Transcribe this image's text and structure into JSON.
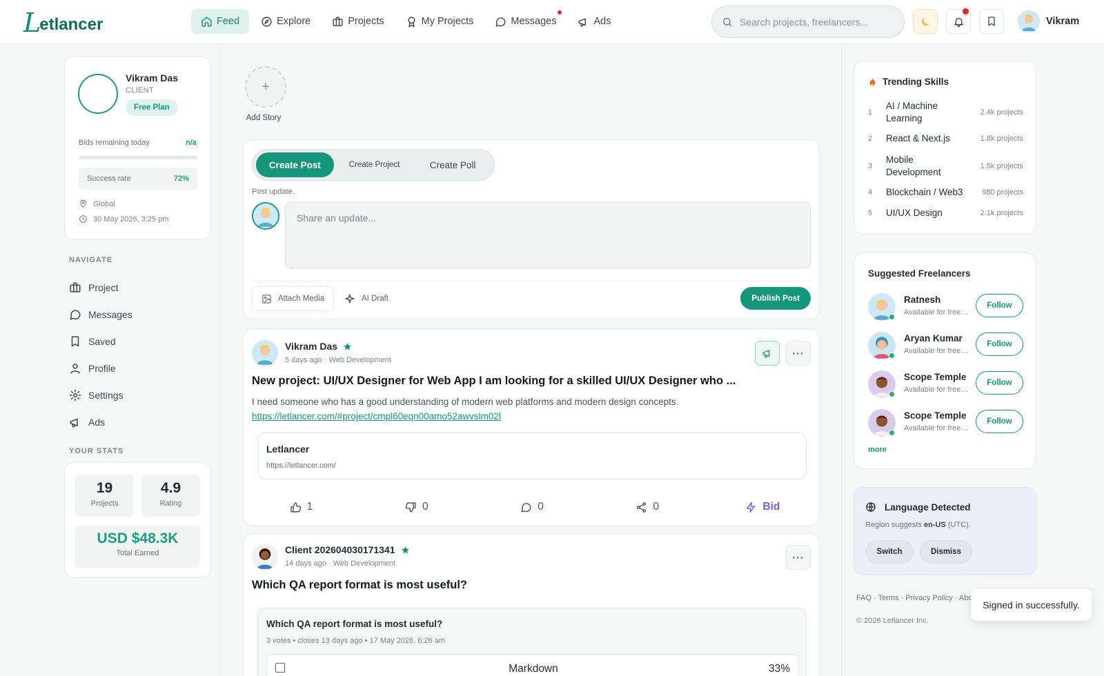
{
  "app": {
    "logo_initial": "L",
    "logo_rest": "etlancer"
  },
  "nav": {
    "items": [
      {
        "label": "Feed",
        "icon": "home-icon"
      },
      {
        "label": "Explore",
        "icon": "compass-icon"
      },
      {
        "label": "Projects",
        "icon": "briefcase-icon"
      },
      {
        "label": "My Projects",
        "icon": "award-icon"
      },
      {
        "label": "Messages",
        "icon": "message-icon"
      },
      {
        "label": "Ads",
        "icon": "megaphone-icon"
      }
    ],
    "active": "Feed"
  },
  "search": {
    "placeholder": "Search projects, freelancers..."
  },
  "user": {
    "name": "Vikram"
  },
  "profile": {
    "name": "Vikram Das",
    "role": "CLIENT",
    "plan": "Free Plan",
    "bids_label": "Bids remaining today",
    "bids_value": "n/a",
    "success_label": "Success rate",
    "success_value": "72%",
    "location": "Global",
    "datetime": "30 May 2026, 3:25 pm"
  },
  "side_nav": {
    "heading": "NAVIGATE",
    "items": [
      {
        "label": "Project"
      },
      {
        "label": "Messages"
      },
      {
        "label": "Saved"
      },
      {
        "label": "Profile"
      },
      {
        "label": "Settings"
      },
      {
        "label": "Ads"
      }
    ]
  },
  "stats": {
    "heading": "YOUR STATS",
    "projects_value": "19",
    "projects_label": "Projects",
    "rating_value": "4.9",
    "rating_label": "Rating",
    "earned_value": "USD $48.3K",
    "earned_label": "Total Earned"
  },
  "story": {
    "label": "Add Story",
    "plus": "+"
  },
  "composer": {
    "tabs": [
      "Create Post",
      "Create Project",
      "Create Poll"
    ],
    "hint": "Post update.",
    "placeholder": "Share an update...",
    "attach_label": "Attach Media",
    "ai_label": "AI Draft",
    "publish_label": "Publish Post"
  },
  "posts": [
    {
      "author": "Vikram Das",
      "meta": "5 days ago · Web Development",
      "title": "New project: UI/UX Designer for Web App I am looking for a skilled UI/UX Designer who ...",
      "body": "I need someone who has a good understanding of modern web platforms and modern design concepts.",
      "link": "https://letlancer.com/#project/cmpl60eqn00amo52awvslm02l",
      "preview_title": "Letlancer",
      "preview_url": "https://letlancer.com/",
      "likes": "1",
      "dislikes": "0",
      "comments": "0",
      "shares": "0",
      "bid_label": "Bid",
      "more": "···"
    },
    {
      "author": "Client 202604030171341",
      "meta": "14 days ago · Web Development",
      "title": "Which QA report format is most useful?",
      "poll_question": "Which QA report format is most useful?",
      "poll_meta": "3 votes • closes 13 days ago • 17 May 2026, 6:26 am",
      "poll_option": "Markdown",
      "poll_pct": "33%",
      "more": "···"
    }
  ],
  "trending": {
    "title": "Trending Skills",
    "items": [
      {
        "rank": "1",
        "name": "AI / Machine Learning",
        "count": "2.4k projects"
      },
      {
        "rank": "2",
        "name": "React & Next.js",
        "count": "1.8k projects"
      },
      {
        "rank": "3",
        "name": "Mobile Development",
        "count": "1.5k projects"
      },
      {
        "rank": "4",
        "name": "Blockchain / Web3",
        "count": "980 projects"
      },
      {
        "rank": "5",
        "name": "UI/UX Design",
        "count": "2.1k projects"
      }
    ]
  },
  "suggested": {
    "title": "Suggested Freelancers",
    "follow_label": "Follow",
    "more_label": "more",
    "items": [
      {
        "name": "Ratnesh",
        "sub": "Available for freelance"
      },
      {
        "name": "Aryan Kumar",
        "sub": "Available for freelance"
      },
      {
        "name": "Scope Temple",
        "sub": "Available for freelance"
      },
      {
        "name": "Scope Temple",
        "sub": "Available for freelance"
      }
    ]
  },
  "language": {
    "title": "Language Detected",
    "sub_prefix": "Region suggests ",
    "locale": "en-US",
    "sub_suffix": " (UTC).",
    "switch_label": "Switch",
    "dismiss_label": "Dismiss"
  },
  "footer": {
    "links": "FAQ · Terms · Privacy Policy · About",
    "copyright": "© 2026 Letlancer Inc."
  },
  "toast": {
    "message": "Signed in successfully."
  },
  "colors": {
    "brand": "#15957c",
    "bid": "#7a55e0",
    "alert": "#e5242b"
  }
}
